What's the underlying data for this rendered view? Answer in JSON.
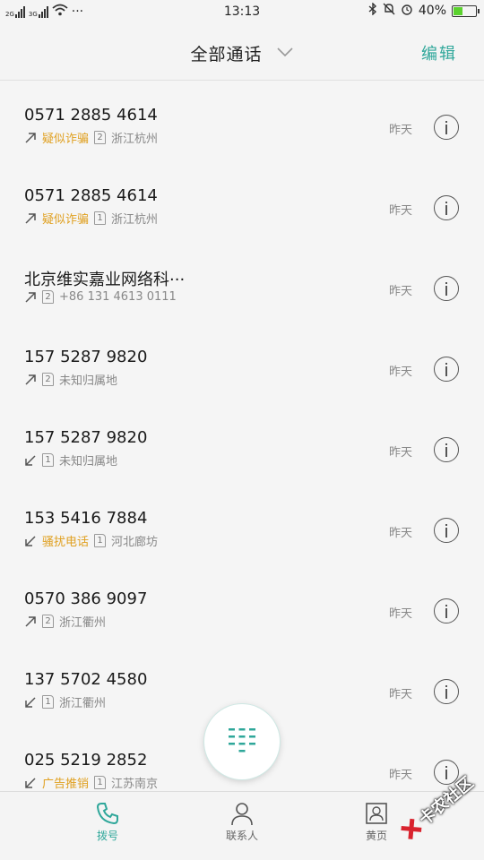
{
  "status_bar": {
    "sim1_label": "2G",
    "sim2_label": "3G",
    "more": "···",
    "time": "13:13",
    "battery_percent_text": "40%",
    "battery_level": 0.4,
    "battery_color": "#5bd22e"
  },
  "header": {
    "title": "全部通话",
    "edit_label": "编辑"
  },
  "colors": {
    "accent": "#2fa79a",
    "warning_tag": "#e0a020"
  },
  "calls": [
    {
      "number": "0571 2885 4614",
      "direction": "outgoing",
      "tag": "疑似诈骗",
      "sim": "2",
      "location": "浙江杭州",
      "date": "昨天"
    },
    {
      "number": "0571 2885 4614",
      "direction": "outgoing",
      "tag": "疑似诈骗",
      "sim": "1",
      "location": "浙江杭州",
      "date": "昨天"
    },
    {
      "number": "北京维实嘉业网络科···",
      "direction": "outgoing",
      "tag": "",
      "sim": "2",
      "location": "+86 131 4613 0111",
      "date": "昨天"
    },
    {
      "number": "157 5287 9820",
      "direction": "outgoing",
      "tag": "",
      "sim": "2",
      "location": "未知归属地",
      "date": "昨天"
    },
    {
      "number": "157 5287 9820",
      "direction": "incoming",
      "tag": "",
      "sim": "1",
      "location": "未知归属地",
      "date": "昨天"
    },
    {
      "number": "153 5416 7884",
      "direction": "incoming",
      "tag": "骚扰电话",
      "sim": "1",
      "location": "河北廊坊",
      "date": "昨天"
    },
    {
      "number": "0570 386 9097",
      "direction": "outgoing",
      "tag": "",
      "sim": "2",
      "location": "浙江衢州",
      "date": "昨天"
    },
    {
      "number": "137 5702 4580",
      "direction": "incoming",
      "tag": "",
      "sim": "1",
      "location": "浙江衢州",
      "date": "昨天"
    },
    {
      "number": "025 5219 2852",
      "direction": "incoming",
      "tag": "广告推销",
      "sim": "1",
      "location": "江苏南京",
      "date": "昨天"
    }
  ],
  "bottom_nav": {
    "dial_label": "拨号",
    "contacts_label": "联系人",
    "yellow_pages_label": "黄页"
  },
  "watermark": {
    "text": "卡农社区"
  }
}
